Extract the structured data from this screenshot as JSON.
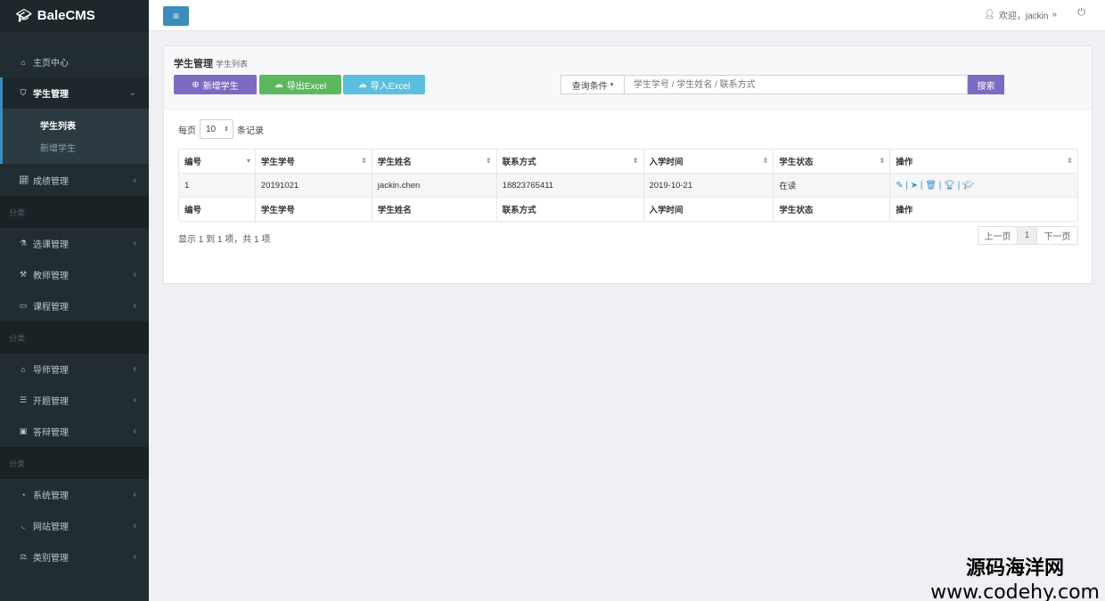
{
  "brand": {
    "name": "BaleCMS",
    "icon": "graduation-cap-icon"
  },
  "sidebar": {
    "items": [
      {
        "label": "主页中心",
        "icon": "home-icon"
      },
      {
        "label": "学生管理",
        "icon": "graduation-cap-icon"
      },
      {
        "label": "成绩管理",
        "icon": "chart-icon"
      }
    ],
    "sub_items": [
      "学生列表",
      "新增学生"
    ],
    "sections": [
      {
        "label": "分类",
        "items": [
          {
            "label": "选课管理",
            "icon": "flask-icon"
          },
          {
            "label": "教师管理",
            "icon": "gavel-icon"
          },
          {
            "label": "课程管理",
            "icon": "desktop-icon"
          }
        ]
      },
      {
        "label": "分类",
        "items": [
          {
            "label": "导师管理",
            "icon": "bank-icon"
          },
          {
            "label": "开题管理",
            "icon": "list-icon"
          },
          {
            "label": "答辩管理",
            "icon": "briefcase-icon"
          }
        ]
      },
      {
        "label": "分类",
        "items": [
          {
            "label": "系统管理",
            "icon": "tachometer-icon"
          },
          {
            "label": "网站管理",
            "icon": "rss-icon"
          },
          {
            "label": "类别管理",
            "icon": "balance-icon"
          }
        ]
      }
    ]
  },
  "header": {
    "welcome": "欢迎，jackin",
    "user_icon": "user-icon",
    "power_icon": "power-icon"
  },
  "page": {
    "title": "学生管理",
    "subtitle": "学生列表"
  },
  "toolbar": {
    "add_label": "新增学生",
    "export_label": "导出Excel",
    "import_label": "导入Excel",
    "condition_label": "查询条件",
    "search_placeholder": "学生学号 / 学生姓名 / 联系方式",
    "search_label": "搜索"
  },
  "per_page": {
    "prefix": "每页",
    "value": "10",
    "suffix": "条记录"
  },
  "table": {
    "columns": [
      "编号",
      "学生学号",
      "学生姓名",
      "联系方式",
      "入学时间",
      "学生状态",
      "操作"
    ],
    "rows": [
      [
        "1",
        "20191021",
        "jackin.chen",
        "18823765411",
        "2019-10-21",
        "在读"
      ]
    ]
  },
  "pagination": {
    "info": "显示 1 到 1 项，共 1 项",
    "prev": "上一页",
    "current": "1",
    "next": "下一页"
  },
  "watermark": {
    "cn": "源码海洋网",
    "url": "www.codehy.com"
  },
  "colors": {
    "sidebar": "#222d32",
    "primary": "#3c8dbc",
    "purple": "#7c6bc0",
    "green": "#5cb85c",
    "cyan": "#5bc0de"
  }
}
